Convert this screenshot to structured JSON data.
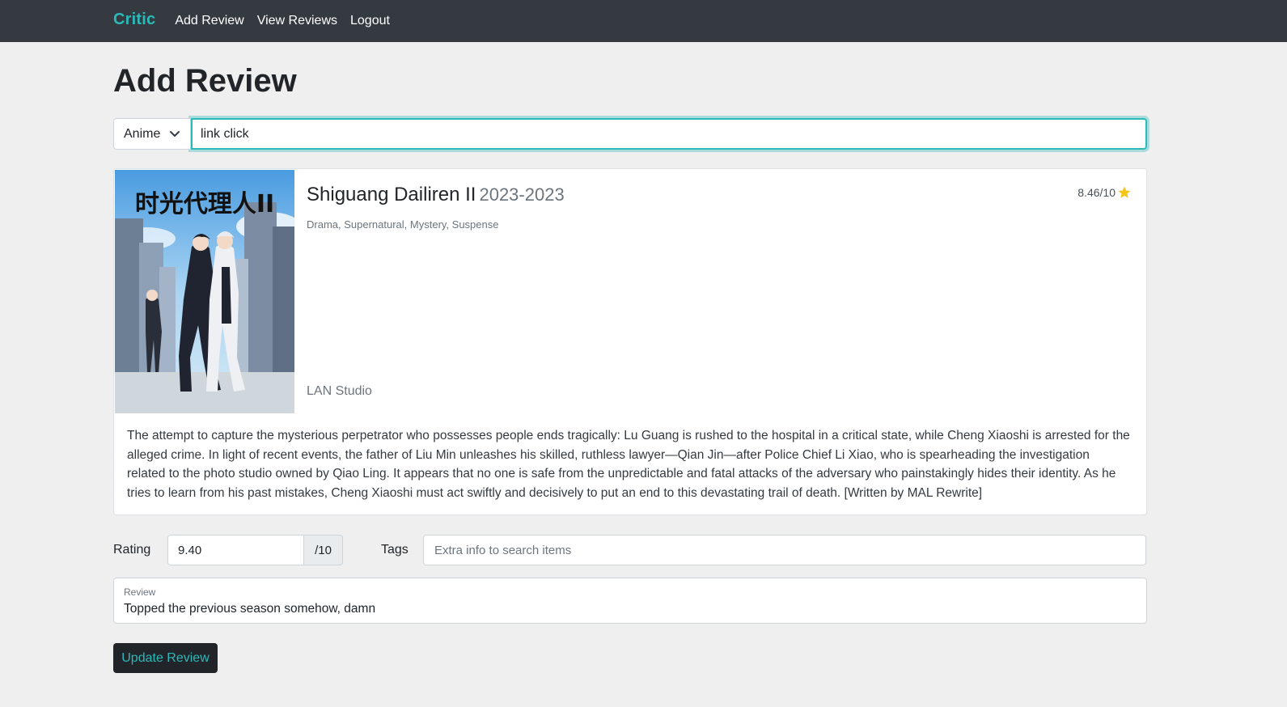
{
  "nav": {
    "brand": "Critic",
    "links": [
      "Add Review",
      "View Reviews",
      "Logout"
    ]
  },
  "page": {
    "title": "Add Review"
  },
  "search": {
    "type_selected": "Anime",
    "query": "link click"
  },
  "result": {
    "title": "Shiguang Dailiren II",
    "years": "2023-2023",
    "genres": "Drama, Supernatural, Mystery, Suspense",
    "score": "8.46/10",
    "studio": "LAN Studio",
    "poster_logo_text": "时光代理人II",
    "synopsis": "The attempt to capture the mysterious perpetrator who possesses people ends tragically: Lu Guang is rushed to the hospital in a critical state, while Cheng Xiaoshi is arrested for the alleged crime. In light of recent events, the father of Liu Min unleashes his skilled, ruthless lawyer—Qian Jin—after Police Chief Li Xiao, who is spearheading the investigation related to the photo studio owned by Qiao Ling. It appears that no one is safe from the unpredictable and fatal attacks of the adversary who painstakingly hides their identity. As he tries to learn from his past mistakes, Cheng Xiaoshi must act swiftly and decisively to put an end to this devastating trail of death. [Written by MAL Rewrite]"
  },
  "form": {
    "rating_label": "Rating",
    "rating_value": "9.40",
    "rating_suffix": "/10",
    "tags_label": "Tags",
    "tags_placeholder": "Extra info to search items",
    "review_label": "Review",
    "review_text": "Topped the previous season somehow, damn",
    "submit_label": "Update Review"
  },
  "colors": {
    "accent": "#2bb9b9",
    "navbar": "#343a40",
    "star": "#f5c518"
  }
}
